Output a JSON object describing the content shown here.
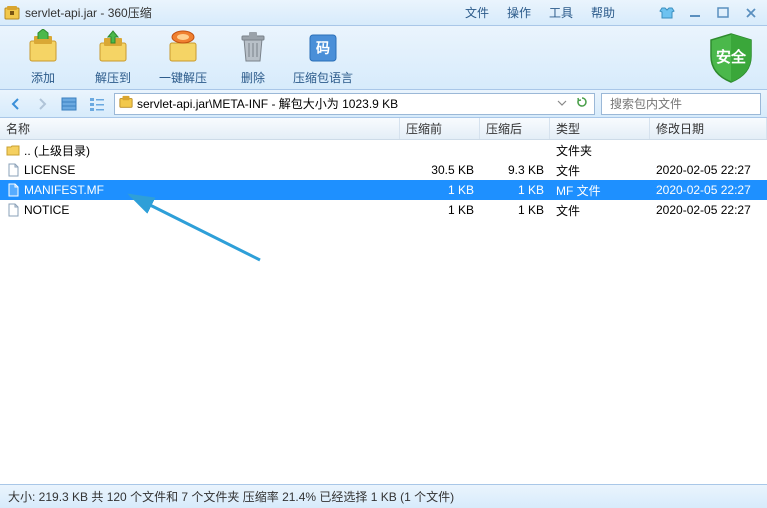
{
  "window": {
    "title": "servlet-api.jar - 360压缩"
  },
  "menu": {
    "file": "文件",
    "operate": "操作",
    "tool": "工具",
    "help": "帮助"
  },
  "toolbar": {
    "add": "添加",
    "extract_to": "解压到",
    "one_click": "一键解压",
    "delete": "删除",
    "language": "压缩包语言",
    "shield": "安全"
  },
  "path": {
    "text": "servlet-api.jar\\META-INF - 解包大小为 1023.9 KB"
  },
  "search": {
    "placeholder": "搜索包内文件"
  },
  "columns": {
    "name": "名称",
    "before": "压缩前",
    "after": "压缩后",
    "type": "类型",
    "date": "修改日期"
  },
  "files": [
    {
      "icon": "folder-up",
      "name": ".. (上级目录)",
      "before": "",
      "after": "",
      "type": "文件夹",
      "date": "",
      "selected": false
    },
    {
      "icon": "file",
      "name": "LICENSE",
      "before": "30.5 KB",
      "after": "9.3 KB",
      "type": "文件",
      "date": "2020-02-05 22:27",
      "selected": false
    },
    {
      "icon": "file",
      "name": "MANIFEST.MF",
      "before": "1 KB",
      "after": "1 KB",
      "type": "MF 文件",
      "date": "2020-02-05 22:27",
      "selected": true
    },
    {
      "icon": "file",
      "name": "NOTICE",
      "before": "1 KB",
      "after": "1 KB",
      "type": "文件",
      "date": "2020-02-05 22:27",
      "selected": false
    }
  ],
  "status": {
    "text": "大小: 219.3 KB 共 120 个文件和 7 个文件夹 压缩率 21.4% 已经选择 1 KB (1 个文件)"
  }
}
